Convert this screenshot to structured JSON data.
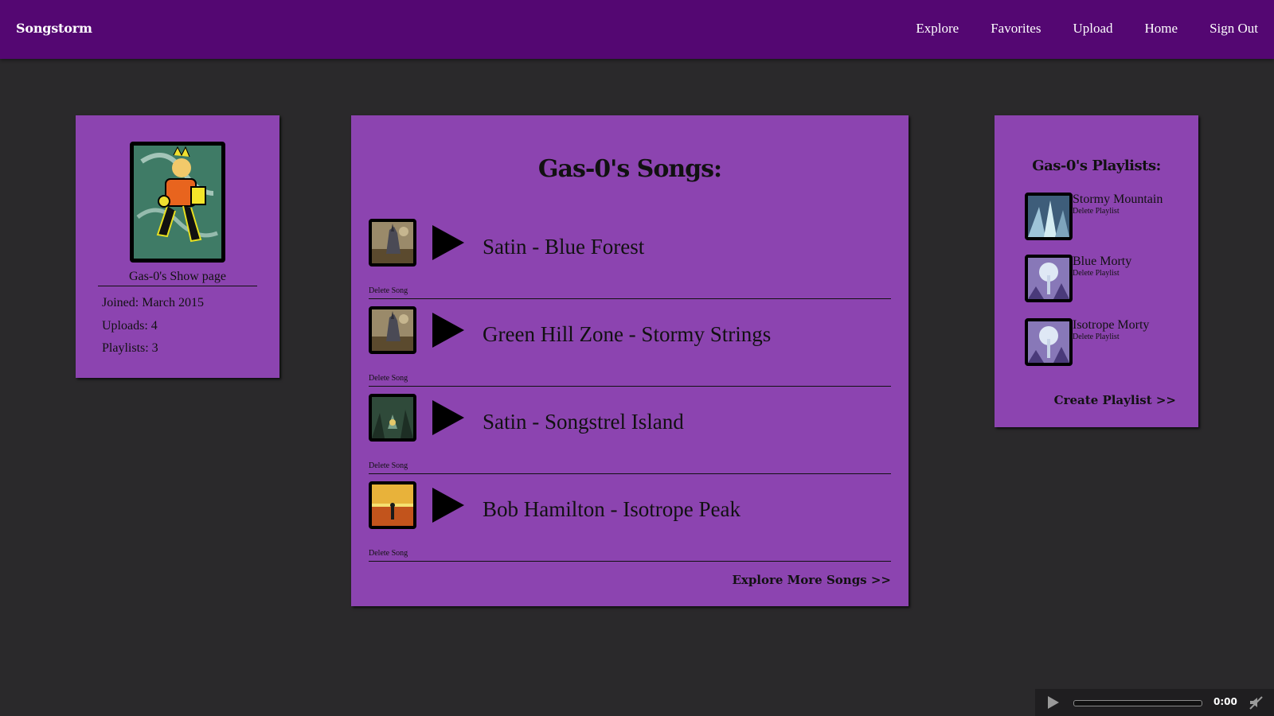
{
  "header": {
    "brand": "Songstorm",
    "nav": [
      "Explore",
      "Favorites",
      "Upload",
      "Home",
      "Sign Out"
    ]
  },
  "profile": {
    "title": "Gas-0's Show page",
    "joined": "Joined: March 2015",
    "uploads": "Uploads: 4",
    "playlists": "Playlists: 3"
  },
  "songs": {
    "title": "Gas-0's Songs:",
    "items": [
      {
        "name": "Satin - Blue Forest",
        "delete": "Delete Song"
      },
      {
        "name": "Green Hill Zone - Stormy Strings",
        "delete": "Delete Song"
      },
      {
        "name": "Satin - Songstrel Island",
        "delete": "Delete Song"
      },
      {
        "name": "Bob Hamilton - Isotrope Peak",
        "delete": "Delete Song"
      }
    ],
    "explore_more": "Explore More Songs >>"
  },
  "playlists": {
    "title": "Gas-0's Playlists:",
    "items": [
      {
        "name": "Stormy Mountain",
        "delete": "Delete Playlist"
      },
      {
        "name": "Blue Morty",
        "delete": "Delete Playlist"
      },
      {
        "name": "Isotrope Morty",
        "delete": "Delete Playlist"
      }
    ],
    "create": "Create Playlist >>"
  },
  "player": {
    "time": "0:00",
    "progress": 0
  },
  "colors": {
    "topbar": "#540772",
    "background": "#2a292b",
    "card": "#8c44b0"
  }
}
